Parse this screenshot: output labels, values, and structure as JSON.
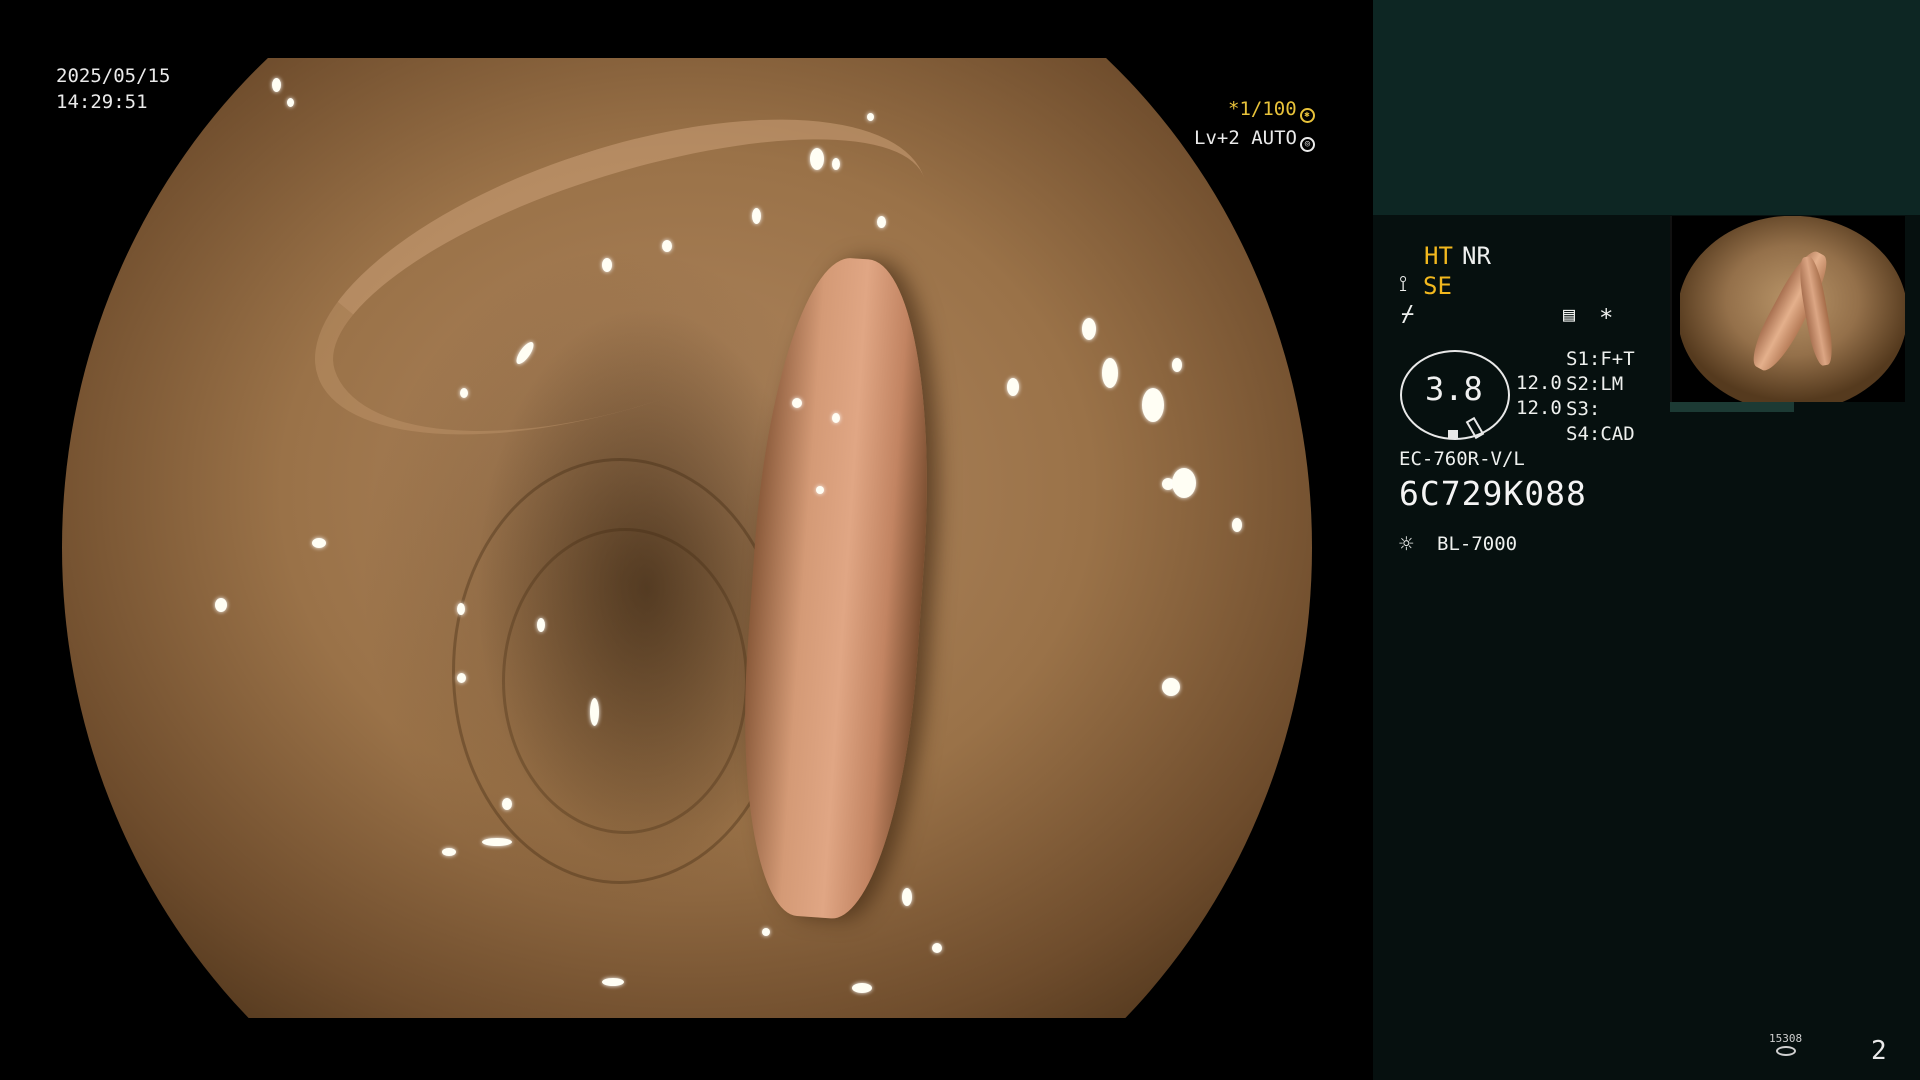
{
  "osd": {
    "date": "2025/05/15",
    "time": "14:29:51",
    "shutter": "*1/100",
    "level": "Lv+2 AUTO"
  },
  "panel": {
    "ht": "HT",
    "nr": "NR",
    "se": "SE",
    "asterisk": "*",
    "fstop": "3.8",
    "val1": "12.0",
    "val2": "12.0",
    "s1": "S1:F+T",
    "s2": "S2:LM",
    "s3": "S3:",
    "s4": "S4:CAD",
    "scope_model": "EC-760R-V/L",
    "serial": "6C729K088",
    "light_source": "BL-7000",
    "counter": "15308",
    "page_number": "2"
  },
  "icons": {
    "shutter": "aperture-icon",
    "level": "iris-icon",
    "se": "structure-enhance-icon",
    "edge": "edge-icon",
    "image_mode": "image-mode-icon",
    "light": "light-source-icon",
    "counter": "record-icon"
  },
  "colors": {
    "accent_yellow": "#f2b81e",
    "panel_top": "#0d2623",
    "panel_bg": "#06100f"
  }
}
